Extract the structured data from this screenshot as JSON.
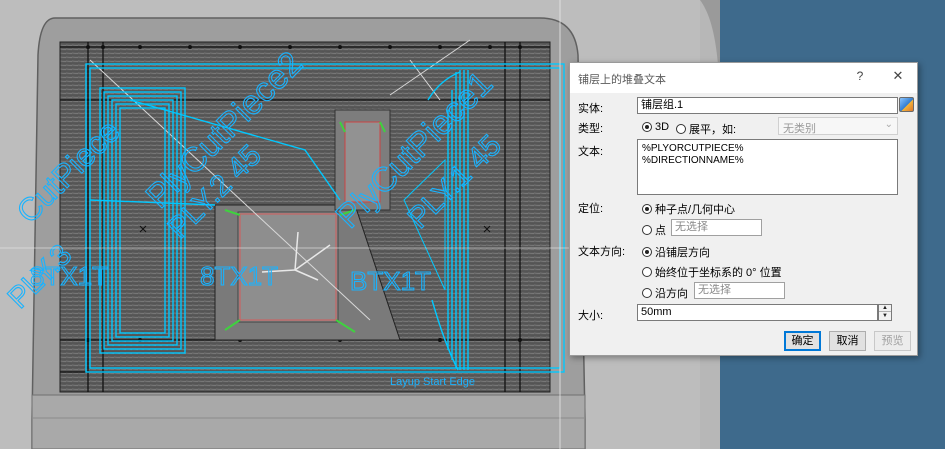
{
  "viewport": {
    "labels": {
      "ply_cut_piece_2": "PlyCutPiece2",
      "ply_cut_piece_1": "PlyCutPiece1",
      "ply_cut_piece_left": "CutPiece",
      "ply_2_45": "PLY.2 45",
      "ply_1_45": "PLY.1 45",
      "ply_3": "PLY.3",
      "direction_left": "8TX1T",
      "direction_bottom_left": "8TX1T",
      "direction_middle": "8TX1T",
      "direction_right": "BTX1T",
      "layup_start_edge": "Layup Start Edge"
    }
  },
  "dialog": {
    "title": "铺层上的堆叠文本",
    "help_label": "?",
    "close_label": "✕",
    "entity": {
      "label": "实体:",
      "value": "铺层组.1"
    },
    "type": {
      "label": "类型:",
      "opt_3d": "3D",
      "opt_flatten": "展平，如:",
      "select_value": "无类别"
    },
    "text": {
      "label": "文本:",
      "lines": [
        "%PLYORCUTPIECE%",
        "%DIRECTIONNAME%"
      ]
    },
    "position": {
      "label": "定位:",
      "opt_seed": "种子点/几何中心",
      "opt_point": "点",
      "point_placeholder": "无选择"
    },
    "direction": {
      "label": "文本方向:",
      "opt_ply": "沿铺层方向",
      "opt_axis": "始终位于坐标系的 0° 位置",
      "opt_along": "沿方向",
      "along_placeholder": "无选择"
    },
    "size": {
      "label": "大小:",
      "value": "50mm"
    },
    "buttons": {
      "ok": "确定",
      "cancel": "取消",
      "preview": "预览"
    }
  },
  "colors": {
    "ply_text": "#19b3ff",
    "ply_outline": "#00c8ff",
    "mold": "#5a5a5a",
    "background_right": "#3e6a8c",
    "dialog_bg": "#f0f0f0"
  }
}
